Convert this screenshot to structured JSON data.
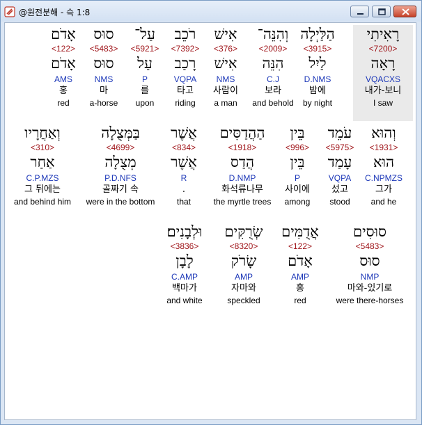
{
  "window": {
    "title": "@원전분해 - 슥 1:8"
  },
  "rows": [
    [
      {
        "heb": "רָאִיתִי",
        "strong": "<7200>",
        "lemma": "רָאָה",
        "parse": "VQACXS",
        "kor": "내가-보니",
        "eng": "I saw",
        "selected": true
      },
      {
        "heb": "הַלַּיְלָה",
        "strong": "<3915>",
        "lemma": "לַיִל",
        "parse": "D.NMS",
        "kor": "밤에",
        "eng": "by night"
      },
      {
        "heb": "וְהִנֵּה־",
        "strong": "<2009>",
        "lemma": "הִנֵּה",
        "parse": "C.J",
        "kor": "보라",
        "eng": "and behold"
      },
      {
        "heb": "אִישׁ",
        "strong": "<376>",
        "lemma": "אִישׁ",
        "parse": "NMS",
        "kor": "사람이",
        "eng": "a man"
      },
      {
        "heb": "רֹכֵב",
        "strong": "<7392>",
        "lemma": "רָכַב",
        "parse": "VQPA",
        "kor": "타고",
        "eng": "riding"
      },
      {
        "heb": "עַל־",
        "strong": "<5921>",
        "lemma": "עַל",
        "parse": "P",
        "kor": "를",
        "eng": "upon"
      },
      {
        "heb": "סוּס",
        "strong": "<5483>",
        "lemma": "סוּס",
        "parse": "NMS",
        "kor": "마",
        "eng": "a-horse"
      },
      {
        "heb": "אָדֹם",
        "strong": "<122>",
        "lemma": "אָדֹם",
        "parse": "AMS",
        "kor": "홍",
        "eng": "red"
      }
    ],
    [
      {
        "heb": "וְהוּא",
        "strong": "<1931>",
        "lemma": "הוּא",
        "parse": "C.NPMZS",
        "kor": "그가",
        "eng": "and he"
      },
      {
        "heb": "עֹמֵד",
        "strong": "<5975>",
        "lemma": "עָמַד",
        "parse": "VQPA",
        "kor": "섰고",
        "eng": "stood"
      },
      {
        "heb": "בֵּין",
        "strong": "<996>",
        "lemma": "בֵּין",
        "parse": "P",
        "kor": "사이에",
        "eng": "among"
      },
      {
        "heb": "הַהֲדַסִּים",
        "strong": "<1918>",
        "lemma": "הֲדַס",
        "parse": "D.NMP",
        "kor": "화석류나무",
        "eng": "the myrtle trees"
      },
      {
        "heb": "אֲשֶׁר",
        "strong": "<834>",
        "lemma": "אֲשֶׁר",
        "parse": "R",
        "kor": ".",
        "eng": "that"
      },
      {
        "heb": "בַּמְּצֻלָה",
        "strong": "<4699>",
        "lemma": "מְצֻלָה",
        "parse": "P.D.NFS",
        "kor": "골짜기 속",
        "eng": "were in the bottom"
      },
      {
        "heb": "וְאַחֲרָיו",
        "strong": "<310>",
        "lemma": "אַחַר",
        "parse": "C.P.MZS",
        "kor": "그 뒤에는",
        "eng": "and behind him"
      }
    ],
    [
      {
        "heb": "סוּסִים",
        "strong": "<5483>",
        "lemma": "סוּס",
        "parse": "NMP",
        "kor": "마와-있기로",
        "eng": "were there-horses"
      },
      {
        "heb": "אֲדֻמִּים",
        "strong": "<122>",
        "lemma": "אָדֹם",
        "parse": "AMP",
        "kor": "홍",
        "eng": "red"
      },
      {
        "heb": "שְׂרֻקִּים",
        "strong": "<8320>",
        "lemma": "שָׂרֹק",
        "parse": "AMP",
        "kor": "자마와",
        "eng": "speckled"
      },
      {
        "heb": "וּלְבָנִים׃",
        "strong": "<3836>",
        "lemma": "לָבָן",
        "parse": "C.AMP",
        "kor": "백마가",
        "eng": "and white"
      }
    ]
  ]
}
